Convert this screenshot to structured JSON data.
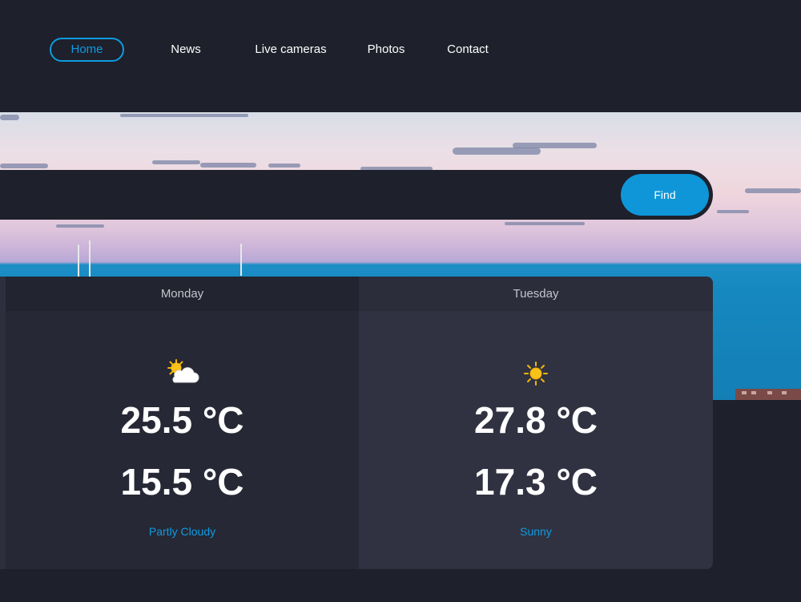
{
  "nav": {
    "items": [
      {
        "label": "Home",
        "active": true
      },
      {
        "label": "News",
        "active": false
      },
      {
        "label": "Live cameras",
        "active": false
      },
      {
        "label": "Photos",
        "active": false
      },
      {
        "label": "Contact",
        "active": false
      }
    ]
  },
  "search": {
    "value": "",
    "button_label": "Find"
  },
  "forecast": [
    {
      "day": "Monday",
      "max": "25.5 °C",
      "min": "15.5 °C",
      "condition": "Partly Cloudy",
      "icon": "partly-cloudy-icon"
    },
    {
      "day": "Tuesday",
      "max": "27.8 °C",
      "min": "17.3 °C",
      "condition": "Sunny",
      "icon": "sun-icon"
    }
  ],
  "colors": {
    "background": "#1e202b",
    "accent": "#0e9be0",
    "card_monday": "#262835",
    "card_tuesday": "#303241"
  }
}
